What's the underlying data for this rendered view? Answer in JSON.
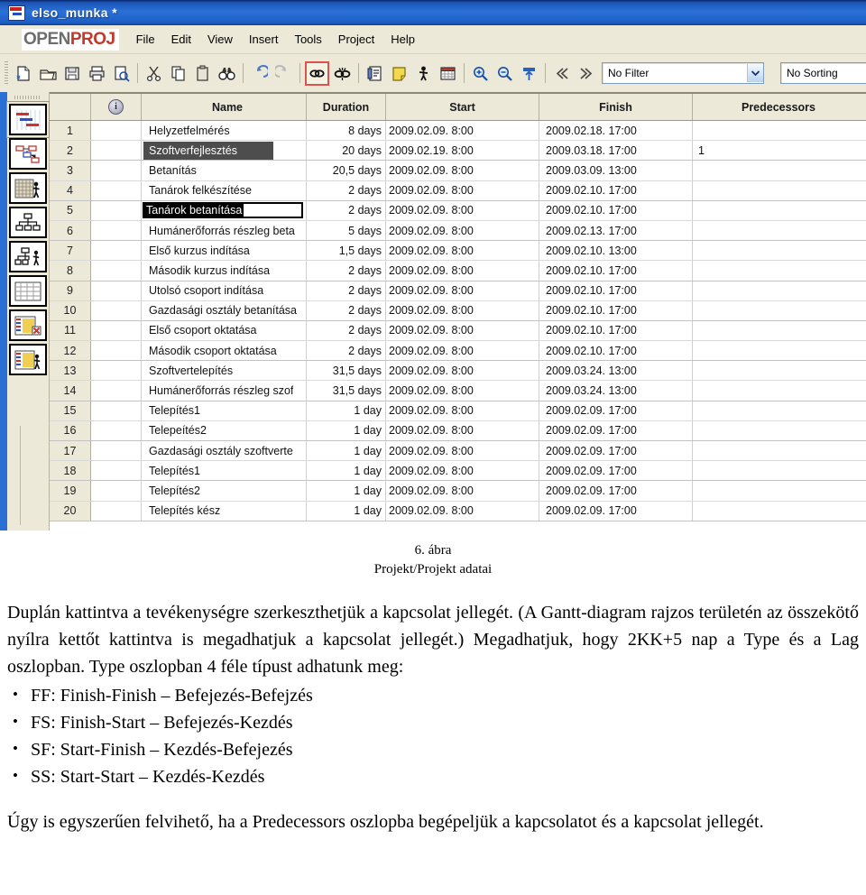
{
  "window": {
    "title": "elso_munka *",
    "title_icon": "openproj-document-icon"
  },
  "menubar": {
    "brand_open": "OPEN",
    "brand_proj": "PROJ",
    "items": [
      {
        "label": "File"
      },
      {
        "label": "Edit"
      },
      {
        "label": "View"
      },
      {
        "label": "Insert"
      },
      {
        "label": "Tools"
      },
      {
        "label": "Project"
      },
      {
        "label": "Help"
      }
    ]
  },
  "toolbar": {
    "buttons": [
      {
        "icon": "new-document-icon",
        "active": false
      },
      {
        "icon": "open-folder-icon",
        "active": false
      },
      {
        "icon": "save-floppy-icon",
        "active": false
      },
      {
        "icon": "print-icon",
        "active": false
      },
      {
        "icon": "print-preview-icon",
        "active": false
      },
      {
        "icon": "cut-scissors-icon",
        "active": false
      },
      {
        "icon": "copy-icon",
        "active": false
      },
      {
        "icon": "paste-icon",
        "active": false
      },
      {
        "icon": "find-binoculars-icon",
        "active": false
      },
      {
        "icon": "undo-icon",
        "active": false
      },
      {
        "icon": "redo-icon",
        "active": false
      },
      {
        "icon": "link-tasks-icon",
        "active": true
      },
      {
        "icon": "unlink-tasks-icon",
        "active": false
      },
      {
        "icon": "task-information-icon",
        "active": false
      },
      {
        "icon": "task-notes-icon",
        "active": false
      },
      {
        "icon": "assign-resources-icon",
        "active": false
      },
      {
        "icon": "calendar-icon",
        "active": false
      },
      {
        "icon": "zoom-in-icon",
        "active": false
      },
      {
        "icon": "zoom-out-icon",
        "active": false
      },
      {
        "icon": "go-to-task-icon",
        "active": false
      },
      {
        "icon": "outdent-icon",
        "active": false
      },
      {
        "icon": "indent-icon",
        "active": false
      }
    ],
    "filter": {
      "value": "No Filter"
    },
    "sorting": {
      "value": "No Sorting"
    }
  },
  "viewbar": {
    "items": [
      {
        "icon": "gantt-view-icon",
        "selected": true
      },
      {
        "icon": "network-view-icon",
        "selected": false
      },
      {
        "icon": "task-usage-view-icon",
        "selected": false
      },
      {
        "icon": "wbs-view-icon",
        "selected": false
      },
      {
        "icon": "rbs-view-icon",
        "selected": false
      },
      {
        "icon": "resource-sheet-view-icon",
        "selected": false
      },
      {
        "icon": "resource-usage-view-icon",
        "selected": false
      },
      {
        "icon": "report-view-icon",
        "selected": false
      }
    ]
  },
  "grid": {
    "columns": [
      {
        "key": "num",
        "label": ""
      },
      {
        "key": "ind",
        "label": "",
        "icon": "indicator-info-icon"
      },
      {
        "key": "name",
        "label": "Name"
      },
      {
        "key": "dur",
        "label": "Duration"
      },
      {
        "key": "start",
        "label": "Start"
      },
      {
        "key": "finish",
        "label": "Finish"
      },
      {
        "key": "pred",
        "label": "Predecessors"
      }
    ],
    "rows": [
      {
        "num": "1",
        "name": "Helyzetfelmérés",
        "dur": "8 days",
        "start": "2009.02.09. 8:00",
        "finish": "2009.02.18. 17:00",
        "pred": "",
        "state": "normal"
      },
      {
        "num": "2",
        "name": "Szoftverfejlesztés",
        "dur": "20 days",
        "start": "2009.02.19. 8:00",
        "finish": "2009.03.18. 17:00",
        "pred": "1",
        "state": "selected"
      },
      {
        "num": "3",
        "name": "Betanítás",
        "dur": "20,5 days",
        "start": "2009.02.09. 8:00",
        "finish": "2009.03.09. 13:00",
        "pred": "",
        "state": "normal"
      },
      {
        "num": "4",
        "name": "Tanárok felkészítése",
        "dur": "2 days",
        "start": "2009.02.09. 8:00",
        "finish": "2009.02.10. 17:00",
        "pred": "",
        "state": "normal"
      },
      {
        "num": "5",
        "name": "Tanárok betanítása",
        "dur": "2 days",
        "start": "2009.02.09. 8:00",
        "finish": "2009.02.10. 17:00",
        "pred": "",
        "state": "editing"
      },
      {
        "num": "6",
        "name": "Humánerőforrás részleg beta",
        "dur": "5 days",
        "start": "2009.02.09. 8:00",
        "finish": "2009.02.13. 17:00",
        "pred": "",
        "state": "normal"
      },
      {
        "num": "7",
        "name": "Első kurzus indítása",
        "dur": "1,5 days",
        "start": "2009.02.09. 8:00",
        "finish": "2009.02.10. 13:00",
        "pred": "",
        "state": "normal"
      },
      {
        "num": "8",
        "name": "Második kurzus indítása",
        "dur": "2 days",
        "start": "2009.02.09. 8:00",
        "finish": "2009.02.10. 17:00",
        "pred": "",
        "state": "normal"
      },
      {
        "num": "9",
        "name": "Utolsó csoport indítása",
        "dur": "2 days",
        "start": "2009.02.09. 8:00",
        "finish": "2009.02.10. 17:00",
        "pred": "",
        "state": "normal"
      },
      {
        "num": "10",
        "name": "Gazdasági osztály betanítása",
        "dur": "2 days",
        "start": "2009.02.09. 8:00",
        "finish": "2009.02.10. 17:00",
        "pred": "",
        "state": "normal"
      },
      {
        "num": "11",
        "name": "Első csoport oktatása",
        "dur": "2 days",
        "start": "2009.02.09. 8:00",
        "finish": "2009.02.10. 17:00",
        "pred": "",
        "state": "normal"
      },
      {
        "num": "12",
        "name": "Második csoport oktatása",
        "dur": "2 days",
        "start": "2009.02.09. 8:00",
        "finish": "2009.02.10. 17:00",
        "pred": "",
        "state": "normal"
      },
      {
        "num": "13",
        "name": "Szoftvertelepítés",
        "dur": "31,5 days",
        "start": "2009.02.09. 8:00",
        "finish": "2009.03.24. 13:00",
        "pred": "",
        "state": "normal"
      },
      {
        "num": "14",
        "name": "Humánerőforrás részleg szof",
        "dur": "31,5 days",
        "start": "2009.02.09. 8:00",
        "finish": "2009.03.24. 13:00",
        "pred": "",
        "state": "normal"
      },
      {
        "num": "15",
        "name": "Telepítés1",
        "dur": "1 day",
        "start": "2009.02.09. 8:00",
        "finish": "2009.02.09. 17:00",
        "pred": "",
        "state": "normal"
      },
      {
        "num": "16",
        "name": "Telepeítés2",
        "dur": "1 day",
        "start": "2009.02.09. 8:00",
        "finish": "2009.02.09. 17:00",
        "pred": "",
        "state": "normal"
      },
      {
        "num": "17",
        "name": "Gazdasági osztály szoftverte",
        "dur": "1 day",
        "start": "2009.02.09. 8:00",
        "finish": "2009.02.09. 17:00",
        "pred": "",
        "state": "normal"
      },
      {
        "num": "18",
        "name": "Telepítés1",
        "dur": "1 day",
        "start": "2009.02.09. 8:00",
        "finish": "2009.02.09. 17:00",
        "pred": "",
        "state": "normal"
      },
      {
        "num": "19",
        "name": "Telepítés2",
        "dur": "1 day",
        "start": "2009.02.09. 8:00",
        "finish": "2009.02.09. 17:00",
        "pred": "",
        "state": "normal"
      },
      {
        "num": "20",
        "name": "Telepítés kész",
        "dur": "1 day",
        "start": "2009.02.09. 8:00",
        "finish": "2009.02.09. 17:00",
        "pred": "",
        "state": "normal"
      }
    ]
  },
  "document": {
    "figure_number": "6. ábra",
    "figure_caption": "Projekt/Projekt adatai",
    "paragraph1": "Duplán kattintva a tevékenységre szerkeszthetjük a kapcsolat jellegét. (A Gantt-diagram rajzos területén az összekötő nyílra kettőt kattintva is megadhatjuk a kapcsolat jellegét.) Megadhatjuk, hogy 2KK+5 nap a Type és a Lag oszlopban. Type oszlopban 4 féle típust adhatunk meg:",
    "bullets": [
      "FF: Finish-Finish – Befejezés-Befejzés",
      "FS: Finish-Start – Befejezés-Kezdés",
      "SF: Start-Finish – Kezdés-Befejezés",
      "SS: Start-Start – Kezdés-Kezdés"
    ],
    "paragraph2": "Úgy is egyszerűen felvihető, ha a Predecessors oszlopba begépeljük a kapcsolatot és a kapcsolat jellegét."
  },
  "colors": {
    "titlebar": "#1b55b5",
    "chrome": "#ece9d8",
    "accent_red": "#c0392b",
    "rail_blue": "#2a6fd4",
    "selection_gray": "#4d4d4d"
  }
}
